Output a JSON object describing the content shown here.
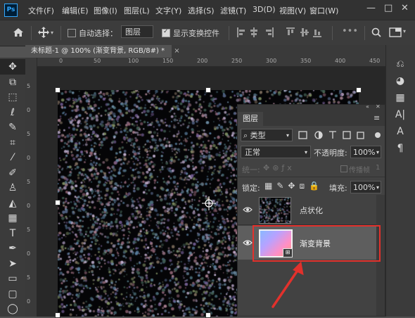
{
  "app": {
    "logo": "Ps"
  },
  "menu": [
    "文件(F)",
    "编辑(E)",
    "图像(I)",
    "图层(L)",
    "文字(Y)",
    "选择(S)",
    "滤镜(T)",
    "3D(D)",
    "视图(V)",
    "窗口(W)"
  ],
  "window_controls": {
    "minimize": "—",
    "maximize": "□",
    "close": "✕"
  },
  "options_bar": {
    "auto_select_label": "自动选择：",
    "auto_select_checked": false,
    "auto_select_target": "图层",
    "show_transform_label": "显示变换控件",
    "show_transform_checked": true
  },
  "document_tab": {
    "title": "未标题-1 @ 100% (渐变背景, RGB/8#) *",
    "close": "×"
  },
  "ruler_top": [
    "0",
    "50",
    "100",
    "150",
    "200",
    "250",
    "300",
    "350",
    "400",
    "450"
  ],
  "ruler_left": [
    "5",
    "0",
    "5",
    "0",
    "5",
    "0",
    "5",
    "0",
    "5",
    "0"
  ],
  "tools": [
    {
      "name": "move-tool",
      "glyph": "✥"
    },
    {
      "name": "artboard-tool",
      "glyph": "⧉"
    },
    {
      "name": "marquee-tool",
      "glyph": "⬚"
    },
    {
      "name": "lasso-tool",
      "glyph": "ℓ"
    },
    {
      "name": "quick-select-tool",
      "glyph": "✎"
    },
    {
      "name": "crop-tool",
      "glyph": "⌗"
    },
    {
      "name": "eyedropper-tool",
      "glyph": "⁄"
    },
    {
      "name": "brush-tool",
      "glyph": "✐"
    },
    {
      "name": "stamp-tool",
      "glyph": "♙"
    },
    {
      "name": "eraser-tool",
      "glyph": "◭"
    },
    {
      "name": "gradient-tool",
      "glyph": "▦"
    },
    {
      "name": "type-tool",
      "glyph": "T"
    },
    {
      "name": "pen-tool",
      "glyph": "✒"
    },
    {
      "name": "path-select-tool",
      "glyph": "➤"
    },
    {
      "name": "rectangle-tool",
      "glyph": "▭"
    },
    {
      "name": "rounded-rect-tool",
      "glyph": "▢"
    },
    {
      "name": "ellipse-tool",
      "glyph": "◯"
    }
  ],
  "right_panel_icons": [
    {
      "name": "history-icon",
      "glyph": "⎌"
    },
    {
      "name": "color-icon",
      "glyph": "◕"
    },
    {
      "name": "swatches-icon",
      "glyph": "▦"
    },
    {
      "name": "character-icon",
      "glyph": "A|"
    },
    {
      "name": "paragraph-style-icon",
      "glyph": "A"
    },
    {
      "name": "paragraph-icon",
      "glyph": "¶"
    }
  ],
  "layers_panel": {
    "title": "图层",
    "filter_kind": "类型",
    "blend_mode": "正常",
    "opacity_label": "不透明度:",
    "opacity_value": "100%",
    "unify_label": "统一:",
    "propagate_label": "传播帧",
    "propagate_value": "1",
    "lock_label": "锁定:",
    "fill_label": "填充:",
    "fill_value": "100%",
    "layers": [
      {
        "name": "点状化",
        "selected": false,
        "visible": true
      },
      {
        "name": "渐变背景",
        "selected": true,
        "visible": true
      }
    ]
  },
  "colors": {
    "highlight": "#e2312c",
    "accent": "#31a8ff"
  }
}
